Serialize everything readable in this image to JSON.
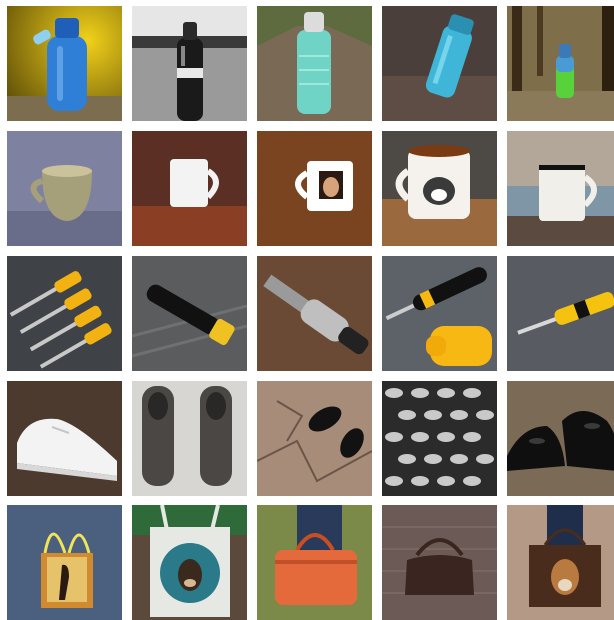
{
  "grid": {
    "rows": [
      {
        "category": "water bottles",
        "tiles": [
          {
            "subject": "blue-water-bottle-on-rock",
            "colors": {
              "bg": "#b59b1d",
              "accent": "#2f7fd6"
            }
          },
          {
            "subject": "black-and-white-bottle-by-lake",
            "colors": {
              "bg": "#9a9a9a",
              "accent": "#1a1a1a"
            }
          },
          {
            "subject": "clear-teal-bottle-on-gravel-path",
            "colors": {
              "bg": "#6f6a55",
              "accent": "#6fd3c6"
            }
          },
          {
            "subject": "teal-bottle-on-dark-ground",
            "colors": {
              "bg": "#4a3f3a",
              "accent": "#3fb6d8"
            }
          },
          {
            "subject": "green-bottle-in-forest",
            "colors": {
              "bg": "#6a5a3a",
              "accent": "#58d23a"
            }
          }
        ]
      },
      {
        "category": "mugs",
        "tiles": [
          {
            "subject": "olive-ceramic-cup",
            "colors": {
              "bg": "#7e81a0",
              "accent": "#a6a07a"
            }
          },
          {
            "subject": "white-mug-on-wood-table",
            "colors": {
              "bg": "#5b2f23",
              "accent": "#f3f3f3"
            }
          },
          {
            "subject": "mug-with-portrait-print",
            "colors": {
              "bg": "#6a3b1a",
              "accent": "#ffffff"
            }
          },
          {
            "subject": "tea-mug-with-cat-print",
            "colors": {
              "bg": "#4d4a46",
              "accent": "#f5f2ee"
            }
          },
          {
            "subject": "white-enamel-mug-on-shelf",
            "colors": {
              "bg": "#9b8f82",
              "accent": "#f1efea"
            }
          }
        ]
      },
      {
        "category": "screwdrivers",
        "tiles": [
          {
            "subject": "set-of-yellow-screwdrivers",
            "colors": {
              "bg": "#3f4347",
              "accent": "#f2b211"
            }
          },
          {
            "subject": "black-screwdriver-on-wood",
            "colors": {
              "bg": "#5a5c5d",
              "accent": "#f0c122"
            }
          },
          {
            "subject": "metal-soldering-tool",
            "colors": {
              "bg": "#5e3f2f",
              "accent": "#bfbfbf"
            }
          },
          {
            "subject": "hand-holding-screwdriver",
            "colors": {
              "bg": "#5c6268",
              "accent": "#f7b813"
            }
          },
          {
            "subject": "yellow-screwdriver-gray-background",
            "colors": {
              "bg": "#585c62",
              "accent": "#f4c20f"
            }
          }
        ]
      },
      {
        "category": "shoes",
        "tiles": [
          {
            "subject": "white-sneaker-on-dirt",
            "colors": {
              "bg": "#4d3a2f",
              "accent": "#f3f3f3"
            }
          },
          {
            "subject": "pair-of-gray-leather-shoes",
            "colors": {
              "bg": "#d8d6d2",
              "accent": "#4a4744"
            }
          },
          {
            "subject": "black-shoes-on-cracked-pavement",
            "colors": {
              "bg": "#a78c79",
              "accent": "#121212"
            }
          },
          {
            "subject": "grayscale-rows-of-shoes",
            "colors": {
              "bg": "#2b2b2b",
              "accent": "#c9c9c9"
            }
          },
          {
            "subject": "black-oxford-shoes",
            "colors": {
              "bg": "#7b6a55",
              "accent": "#0f0f10"
            }
          }
        ]
      },
      {
        "category": "bags",
        "tiles": [
          {
            "subject": "tote-bag-with-silhouette-print",
            "colors": {
              "bg": "#4b5f7e",
              "accent": "#d08a2f"
            }
          },
          {
            "subject": "canvas-tote-with-dog-print",
            "colors": {
              "bg": "#5b4a3c",
              "accent": "#e6e8e3"
            }
          },
          {
            "subject": "orange-leather-handbag",
            "colors": {
              "bg": "#7b8a48",
              "accent": "#e46a3c"
            }
          },
          {
            "subject": "brown-handbag-on-brick",
            "colors": {
              "bg": "#6b5a55",
              "accent": "#3a2520"
            }
          },
          {
            "subject": "tote-with-deer-print",
            "colors": {
              "bg": "#b49a86",
              "accent": "#4a2c1c"
            }
          }
        ]
      }
    ]
  }
}
